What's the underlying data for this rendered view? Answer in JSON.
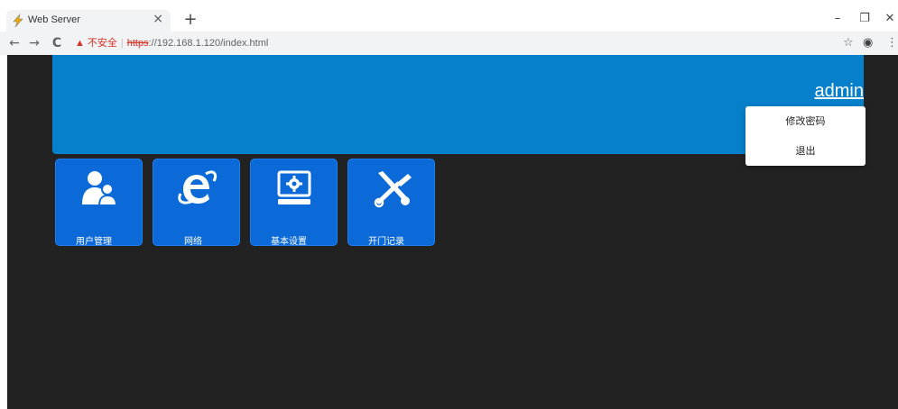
{
  "browser": {
    "tab_title": "Web Server",
    "tab_close": "×",
    "new_tab": "+",
    "window_controls": {
      "minimize": "–",
      "restore": "❐",
      "close": "✕"
    },
    "nav": {
      "back": "←",
      "forward": "→",
      "reload": "C"
    },
    "address": {
      "warning_icon": "▲",
      "security_label": "不安全",
      "separator": "|",
      "scheme": "https",
      "rest": "://192.168.1.120/index.html"
    },
    "toolbar_icons": {
      "bookmark": "☆",
      "account": "◉",
      "menu": "⋮"
    }
  },
  "header": {
    "user_label": "admin",
    "banner_color": "#0680cb"
  },
  "user_menu": {
    "items": [
      {
        "label": "修改密码"
      },
      {
        "label": "退出"
      }
    ]
  },
  "tiles": [
    {
      "label": "用户管理",
      "icon": "users-icon"
    },
    {
      "label": "网络",
      "icon": "internet-explorer-icon"
    },
    {
      "label": "基本设置",
      "icon": "monitor-settings-icon"
    },
    {
      "label": "开门记录",
      "icon": "tools-icon"
    }
  ],
  "colors": {
    "page_background": "#222222",
    "tile_background": "#0c6ad8",
    "insecure_red": "#d93025"
  }
}
